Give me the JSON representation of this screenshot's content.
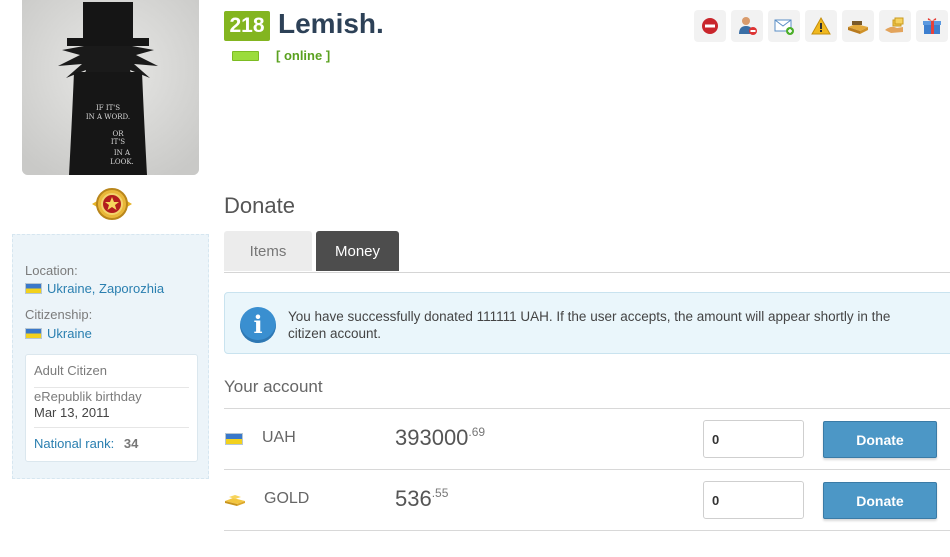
{
  "profile": {
    "level": "218",
    "name": "Lemish.",
    "status": "[ online ]",
    "avatar_text": [
      "IF IT'S",
      "IN A WORD.",
      "OR",
      "IT'S",
      "IN A",
      "LOOK."
    ]
  },
  "actions": [
    {
      "icon": "block-icon"
    },
    {
      "icon": "remove-friend-icon"
    },
    {
      "icon": "message-icon"
    },
    {
      "icon": "report-icon"
    },
    {
      "icon": "donate-items-icon"
    },
    {
      "icon": "donate-money-icon"
    },
    {
      "icon": "gift-icon"
    }
  ],
  "sidebar": {
    "location_label": "Location:",
    "location_value": "Ukraine, Zaporozhia",
    "citizenship_label": "Citizenship:",
    "citizenship_value": "Ukraine",
    "citizen_type": "Adult Citizen",
    "birthday_label": "eRepublik birthday",
    "birthday_value": "Mar 13, 2011",
    "rank_label": "National rank:",
    "rank_value": "34"
  },
  "donate": {
    "title": "Donate",
    "tabs": [
      "Items",
      "Money"
    ],
    "active_tab": "Money",
    "notice": "You have successfully donated 111111 UAH. If the user accepts, the amount will appear shortly in the citizen account.",
    "account_title": "Your account",
    "rows": [
      {
        "currency": "UAH",
        "amount_int": "393000",
        "amount_dec": ".69",
        "input_value": "0",
        "button": "Donate"
      },
      {
        "currency": "GOLD",
        "amount_int": "536",
        "amount_dec": ".55",
        "input_value": "0",
        "button": "Donate"
      }
    ]
  },
  "colors": {
    "level_bg": "#83b520",
    "online": "#5aa11f",
    "link": "#2a7fb0",
    "button": "#4c97c6",
    "active_tab": "#4d4d4d"
  }
}
